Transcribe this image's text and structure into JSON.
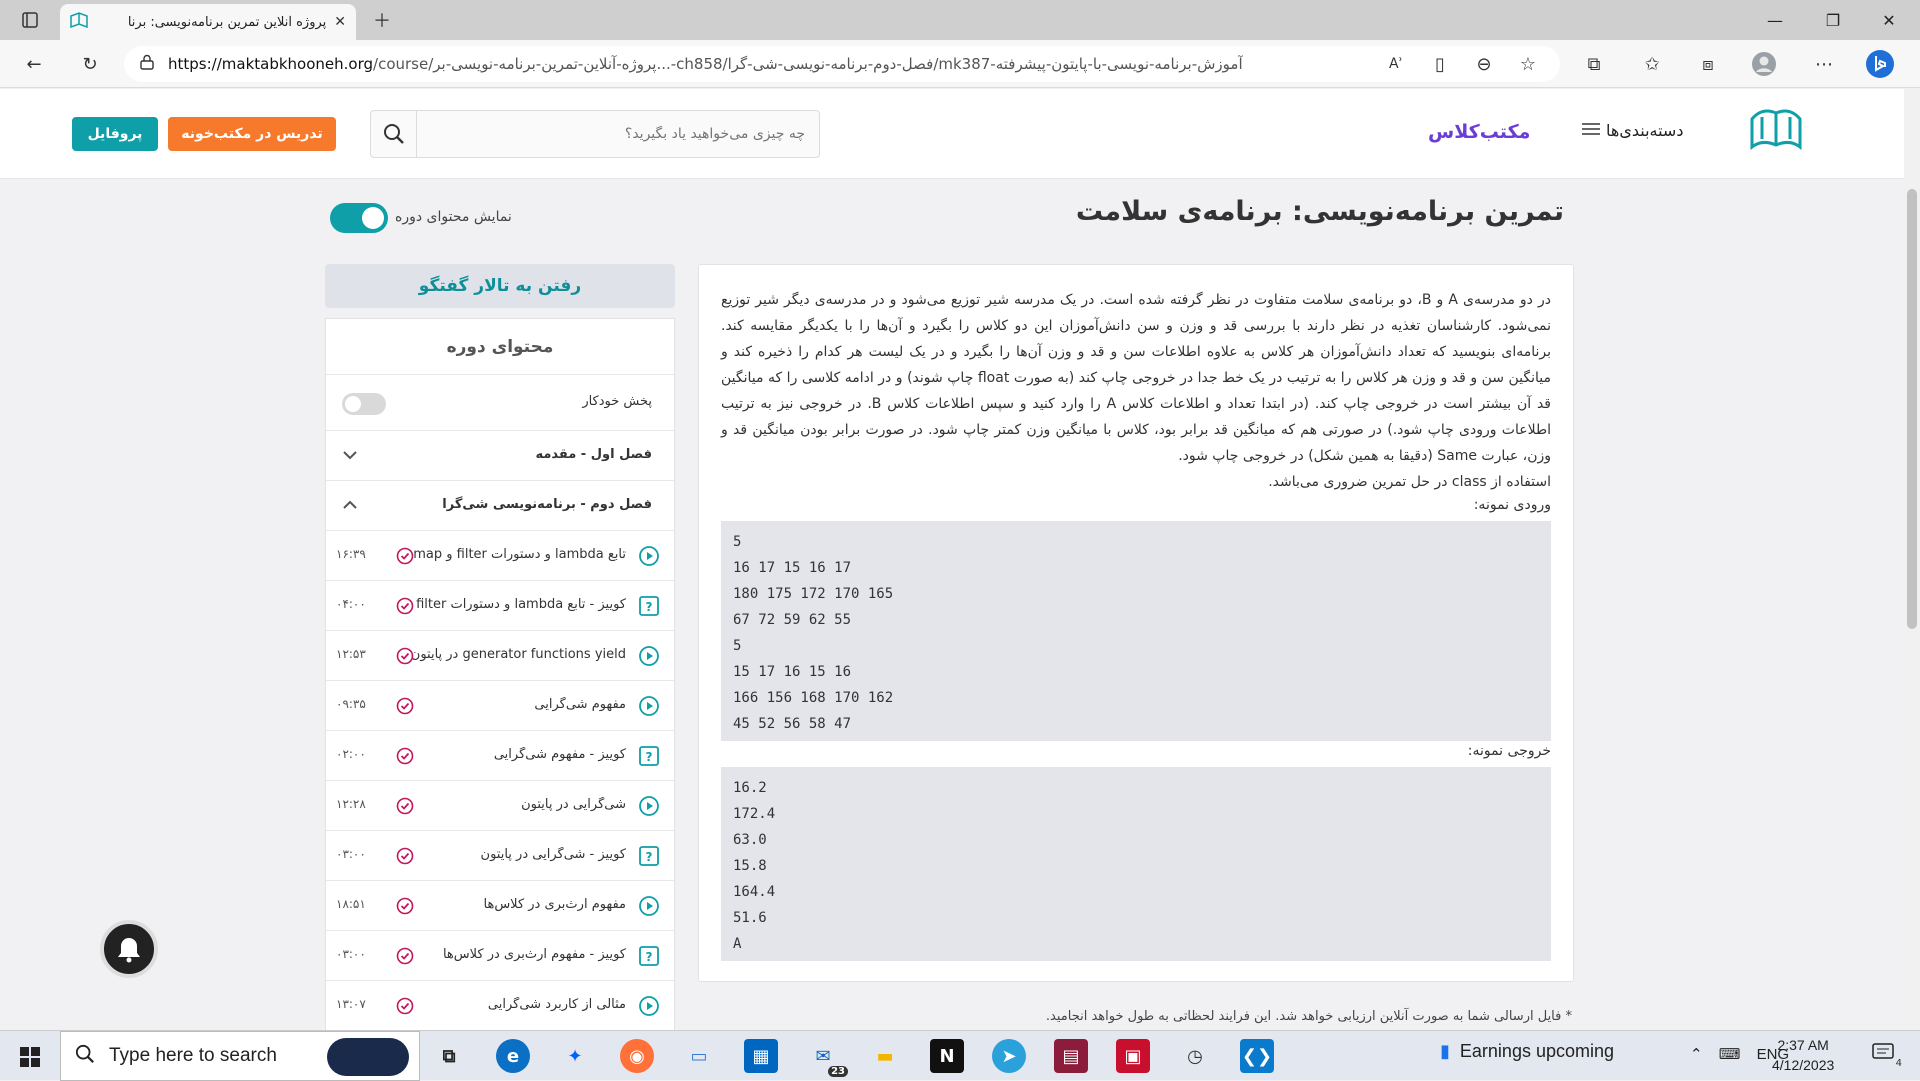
{
  "browser": {
    "tab_title": "پروژه آنلاین تمرین برنامه‌نویسی: برنا",
    "url_host": "https://maktabkhooneh.org",
    "url_path": "/course/پروژه-آنلاین-تمرین-برنامه-نویسی-بر...-ch858/فصل-دوم-برنامه-نویسی-شی-گرا/mk387-آموزش-برنامه-نویسی-با-پایتون-پیشرفته",
    "read_aloud": "Aʾ"
  },
  "header": {
    "profile_button": "پروفایل",
    "teach_button": "تدریس در مکتب‌خونه",
    "search_placeholder": "چه چیزی می‌خواهید یاد بگیرید؟",
    "maktab_class": "مکتب‌کلاس",
    "categories": "دسته‌بندی‌ها"
  },
  "page": {
    "title": "تمرین برنامه‌نویسی: برنامه‌ی سلامت",
    "show_content_label": "نمایش محتوای دوره",
    "description": "در دو مدرسه‌ی A و B، دو برنامه‌ی سلامت متفاوت در نظر گرفته شده است. در یک مدرسه شیر توزیع می‌شود و در مدرسه‌ی دیگر شیر توزیع نمی‌شود. کارشناسان تغذیه در نظر دارند با بررسی قد و وزن و سن دانش‌آموزان این دو کلاس را بگیرد و آن‌ها را با یکدیگر مقایسه کند. برنامه‌ای بنویسید که تعداد دانش‌آموزان هر کلاس به علاوه اطلاعات سن و قد و وزن آن‌ها را بگیرد و در یک لیست هر کدام را ذخیره کند و میانگین سن و قد و وزن هر کلاس را به ترتیب در یک خط جدا در خروجی چاپ کند (به صورت float چاپ شوند) و در ادامه کلاسی را که میانگین قد آن بیشتر است در خروجی چاپ کند. (در ابتدا تعداد و اطلاعات کلاس A را وارد کنید و سپس اطلاعات کلاس B. در خروجی نیز به ترتیب اطلاعات ورودی چاپ شود.) در صورتی هم که میانگین قد برابر بود، کلاس با میانگین وزن کمتر چاپ شود. در صورت برابر بودن میانگین قد و وزن، عبارت Same (دقیقا به همین شکل) در خروجی چاپ شود.",
    "class_note": "استفاده از class در حل تمرین ضروری می‌باشد.",
    "sample_input_label": "ورودی نمونه:",
    "sample_input": [
      "5",
      "16 17 15 16 17",
      "180 175 172 170 165",
      "67 72 59 62 55",
      "5",
      "15 17 16 15 16",
      "166 156 168 170 162",
      "45 52 56 58 47"
    ],
    "sample_output_label": "خروجی نمونه:",
    "sample_output": [
      "16.2",
      "172.4",
      "63.0",
      "15.8",
      "164.4",
      "51.6",
      "A"
    ],
    "footnote": "* فایل ارسالی شما به صورت آنلاین ارزیابی خواهد شد. این فرایند لحظاتی به طول خواهد انجامید."
  },
  "sidebar": {
    "forum_button": "رفتن به تالار گفتگو",
    "title": "محتوای دوره",
    "autoplay_label": "پخش خودکار",
    "chapter1": "فصل اول - مقدمه",
    "chapter2": "فصل دوم - برنامه‌نویسی شی‌گرا",
    "lessons": [
      {
        "title": "تابع lambda و دستورات filter و map",
        "duration": "۱۶:۳۹",
        "type": "video"
      },
      {
        "title": "کوییز - تابع lambda و دستورات filter",
        "duration": "۰۴:۰۰",
        "type": "quiz"
      },
      {
        "title": "generator functions yield در پایتون",
        "duration": "۱۲:۵۳",
        "type": "video"
      },
      {
        "title": "مفهوم شی‌گرایی",
        "duration": "۰۹:۳۵",
        "type": "video"
      },
      {
        "title": "کوییز - مفهوم شی‌گرایی",
        "duration": "۰۲:۰۰",
        "type": "quiz"
      },
      {
        "title": "شی‌گرایی در پایتون",
        "duration": "۱۲:۲۸",
        "type": "video"
      },
      {
        "title": "کوییز - شی‌گرایی در پایتون",
        "duration": "۰۳:۰۰",
        "type": "quiz"
      },
      {
        "title": "مفهوم ارث‌بری در کلاس‌ها",
        "duration": "۱۸:۵۱",
        "type": "video"
      },
      {
        "title": "کوییز - مفهوم ارث‌بری در کلاس‌ها",
        "duration": "۰۳:۰۰",
        "type": "quiz"
      },
      {
        "title": "مثالی از کاربرد شی‌گرایی",
        "duration": "۱۳:۰۷",
        "type": "video"
      }
    ]
  },
  "taskbar": {
    "search_placeholder": "Type here to search",
    "mail_badge": "23",
    "weather": "Earnings upcoming",
    "lang": "ENG",
    "time": "2:37 AM",
    "date": "4/12/2023",
    "notif_count": "4"
  },
  "colors": {
    "teal": "#0f9fa8",
    "orange": "#f7792b",
    "purple": "#6a3dd6",
    "checkmark": "#c2185b"
  }
}
